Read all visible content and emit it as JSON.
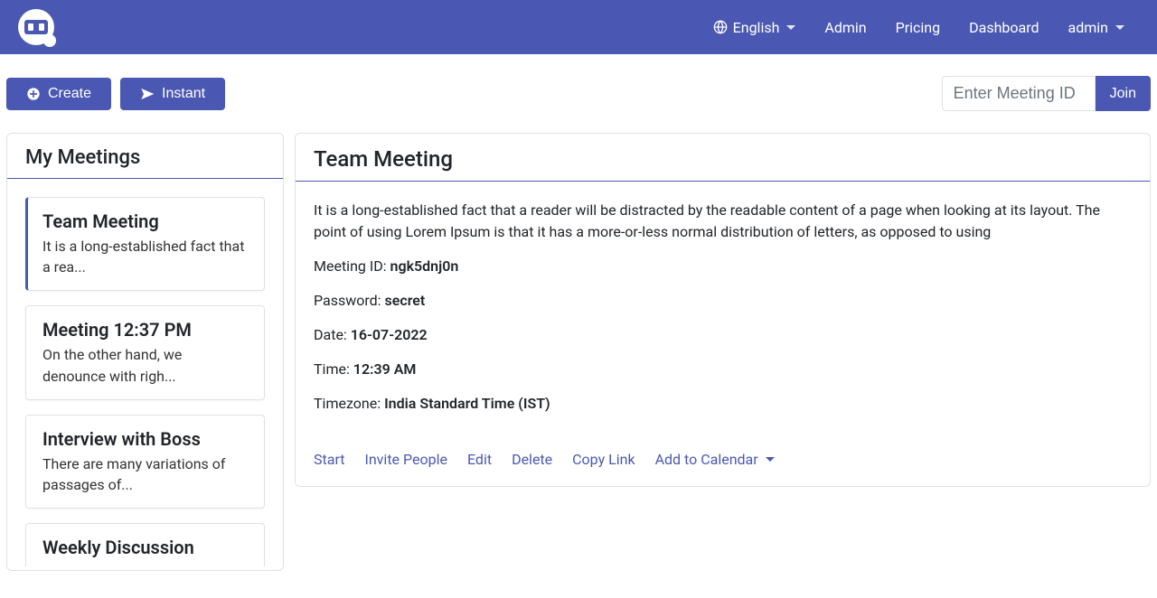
{
  "nav": {
    "language": "English",
    "links": {
      "admin": "Admin",
      "pricing": "Pricing",
      "dashboard": "Dashboard",
      "user": "admin"
    }
  },
  "toolbar": {
    "create": "Create",
    "instant": "Instant",
    "meeting_id_placeholder": "Enter Meeting ID",
    "join": "Join"
  },
  "sidebar": {
    "title": "My Meetings",
    "items": [
      {
        "title": "Team Meeting",
        "excerpt": "It is a long-established fact that a rea...",
        "active": true
      },
      {
        "title": "Meeting 12:37 PM",
        "excerpt": "On the other hand, we denounce with righ...",
        "active": false
      },
      {
        "title": "Interview with Boss",
        "excerpt": "There are many variations of passages of...",
        "active": false
      },
      {
        "title": "Weekly Discussion",
        "excerpt": "",
        "active": false
      }
    ]
  },
  "detail": {
    "title": "Team Meeting",
    "description": "It is a long-established fact that a reader will be distracted by the readable content of a page when looking at its layout. The point of using Lorem Ipsum is that it has a more-or-less normal distribution of letters, as opposed to using",
    "fields": {
      "meeting_id_label": "Meeting ID: ",
      "meeting_id": "ngk5dnj0n",
      "password_label": "Password: ",
      "password": "secret",
      "date_label": "Date: ",
      "date": "16-07-2022",
      "time_label": "Time: ",
      "time": "12:39 AM",
      "timezone_label": "Timezone: ",
      "timezone": "India Standard Time (IST)"
    },
    "actions": {
      "start": "Start",
      "invite": "Invite People",
      "edit": "Edit",
      "delete": "Delete",
      "copy": "Copy Link",
      "calendar": "Add to Calendar"
    }
  }
}
